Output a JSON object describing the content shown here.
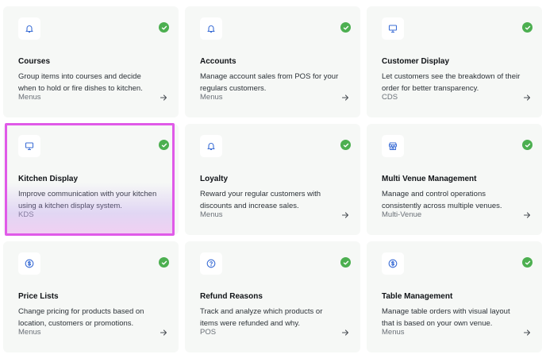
{
  "cards": [
    {
      "icon": "bell-icon",
      "title": "Courses",
      "desc1": "Group items into courses and decide",
      "desc2": "when to hold or fire dishes to kitchen.",
      "category": "Menus"
    },
    {
      "icon": "bell-icon",
      "title": "Accounts",
      "desc1": "Manage account sales from POS for your",
      "desc2": "regulars customers.",
      "category": "Menus"
    },
    {
      "icon": "monitor-icon",
      "title": "Customer Display",
      "desc1": "Let customers see the breakdown of their",
      "desc2": "order for better transparency.",
      "category": "CDS"
    },
    {
      "icon": "monitor-icon",
      "title": "Kitchen Display",
      "desc1": "Improve communication with your kitchen",
      "desc2": "using a kitchen display system.",
      "category": "KDS"
    },
    {
      "icon": "bell-icon",
      "title": "Loyalty",
      "desc1": "Reward your regular customers with",
      "desc2": "discounts and increase sales.",
      "category": "Menus"
    },
    {
      "icon": "store-icon",
      "title": "Multi Venue Management",
      "desc1": "Manage and control operations",
      "desc2": "consistently across multiple venues.",
      "category": "Multi-Venue"
    },
    {
      "icon": "dollar-icon",
      "title": "Price Lists",
      "desc1": "Change pricing for products based on",
      "desc2": "location, customers or promotions.",
      "category": "Menus"
    },
    {
      "icon": "question-icon",
      "title": "Refund Reasons",
      "desc1": "Track and analyze which products or",
      "desc2": "items were refunded and why.",
      "category": "POS"
    },
    {
      "icon": "dollar-icon",
      "title": "Table Management",
      "desc1": "Manage table orders with visual layout",
      "desc2": "that is based on your own venue.",
      "category": "Menus"
    }
  ],
  "colors": {
    "icon": "#3d6fd6",
    "check": "#4caf50",
    "highlight": "#e05ae8"
  }
}
